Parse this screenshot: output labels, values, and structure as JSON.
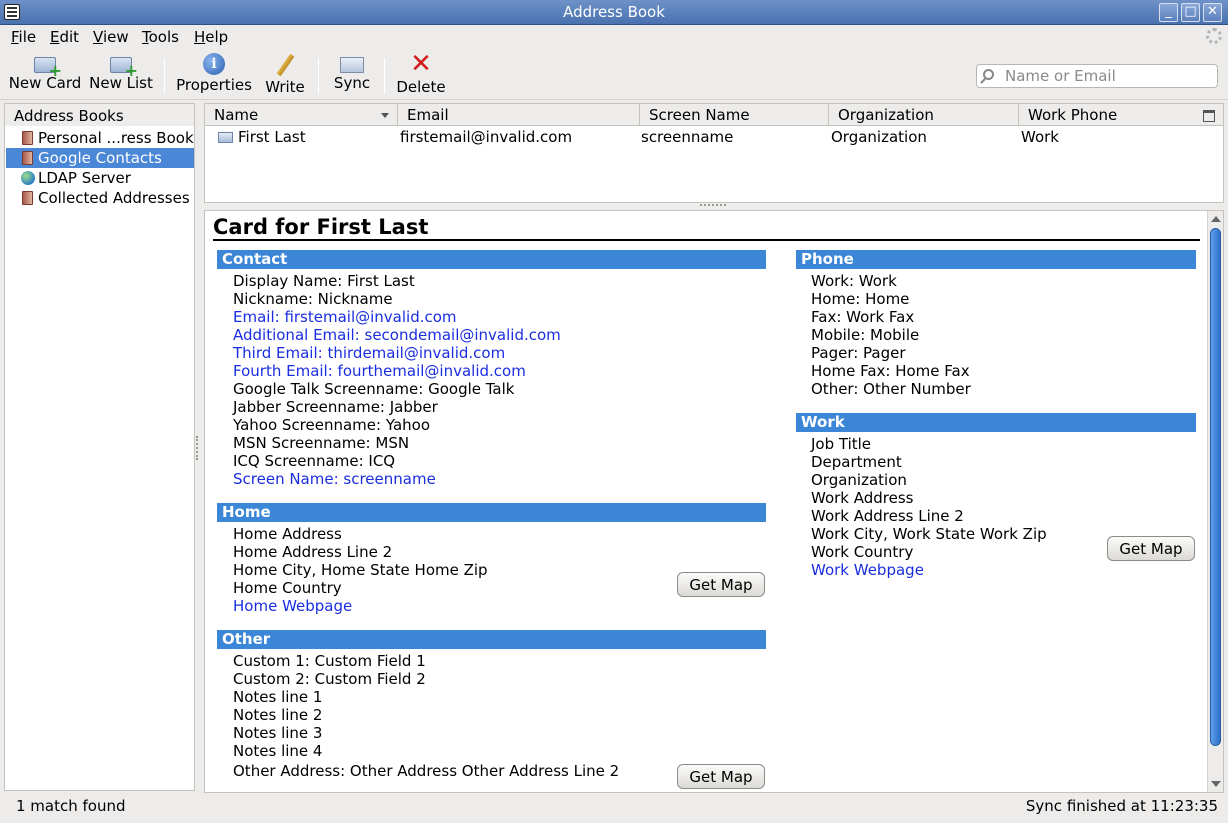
{
  "window": {
    "title": "Address Book"
  },
  "menu": [
    {
      "label": "File",
      "key": "F",
      "rest": "ile"
    },
    {
      "label": "Edit",
      "key": "E",
      "rest": "dit"
    },
    {
      "label": "View",
      "key": "V",
      "rest": "iew"
    },
    {
      "label": "Tools",
      "key": "T",
      "rest": "ools"
    },
    {
      "label": "Help",
      "key": "H",
      "rest": "elp"
    }
  ],
  "toolbar": {
    "new_card": "New Card",
    "new_list": "New List",
    "properties": "Properties",
    "write": "Write",
    "sync": "Sync",
    "delete": "Delete"
  },
  "search": {
    "placeholder": "Name or Email"
  },
  "sidebar": {
    "header": "Address Books",
    "items": [
      {
        "label": "Personal ...ress Book",
        "icon": "address-book-icon"
      },
      {
        "label": "Google Contacts",
        "icon": "address-book-icon",
        "selected": true
      },
      {
        "label": "LDAP Server",
        "icon": "globe-icon"
      },
      {
        "label": "Collected Addresses",
        "icon": "address-book-icon"
      }
    ]
  },
  "list": {
    "columns": [
      "Name",
      "Email",
      "Screen Name",
      "Organization",
      "Work Phone"
    ],
    "rows": [
      {
        "name": "First Last",
        "email": "firstemail@invalid.com",
        "screen_name": "screenname",
        "organization": "Organization",
        "work_phone": "Work"
      }
    ]
  },
  "card": {
    "title": "Card for First Last",
    "contact": {
      "header": "Contact",
      "lines": [
        "Display Name: First Last",
        "Nickname: Nickname",
        "Email: firstemail@invalid.com",
        "Additional Email: secondemail@invalid.com",
        "Third Email: thirdemail@invalid.com",
        "Fourth Email: fourthemail@invalid.com",
        "Google Talk Screenname: Google Talk",
        "Jabber Screenname: Jabber",
        "Yahoo Screenname: Yahoo",
        "MSN Screenname: MSN",
        "ICQ Screenname: ICQ",
        "Screen Name: screenname"
      ]
    },
    "home": {
      "header": "Home",
      "lines": [
        "Home Address",
        "Home Address Line 2",
        "Home City, Home State Home Zip",
        "Home Country",
        "Home Webpage"
      ],
      "map_button": "Get Map"
    },
    "other": {
      "header": "Other",
      "lines": [
        "Custom 1: Custom Field 1",
        "Custom 2: Custom Field 2",
        "Notes line 1",
        "Notes line 2",
        "Notes line 3",
        "Notes line 4",
        "Other Address: Other Address Other Address Line 2"
      ],
      "map_button": "Get Map"
    },
    "phone": {
      "header": "Phone",
      "lines": [
        "Work: Work",
        "Home: Home",
        "Fax: Work Fax",
        "Mobile: Mobile",
        "Pager: Pager",
        "Home Fax: Home Fax",
        "Other: Other Number"
      ]
    },
    "work": {
      "header": "Work",
      "lines": [
        "Job Title",
        "Department",
        "Organization",
        "Work Address",
        "Work Address Line 2",
        "Work City, Work State Work Zip",
        "Work Country",
        "Work Webpage"
      ],
      "map_button": "Get Map"
    }
  },
  "status": {
    "left": "1 match found",
    "right": "Sync finished at 11:23:35"
  },
  "colors": {
    "titlebar": "#4a72b0",
    "selection": "#4a87d6",
    "section_header": "#3b86d6",
    "link": "#1a2ee0",
    "delete_icon": "#d21c1c"
  }
}
